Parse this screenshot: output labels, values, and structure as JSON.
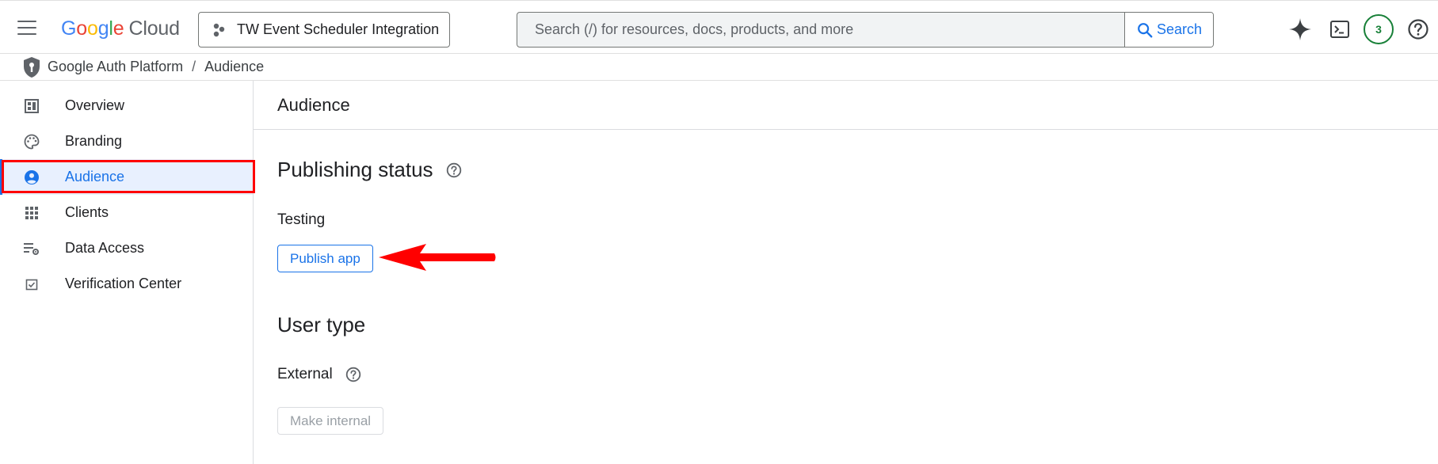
{
  "topbar": {
    "logo": {
      "letters": [
        "G",
        "o",
        "o",
        "g",
        "l",
        "e"
      ],
      "product": "Cloud"
    },
    "project_name": "TW Event Scheduler Integration",
    "search_placeholder": "Search (/) for resources, docs, products, and more",
    "search_button": "Search",
    "notification_count": "3",
    "icons": [
      "menu-icon",
      "gemini-spark-icon",
      "cloud-shell-icon",
      "help-icon"
    ]
  },
  "breadcrumb": {
    "root": "Google Auth Platform",
    "separator": "/",
    "current": "Audience"
  },
  "sidebar": {
    "items": [
      {
        "label": "Overview",
        "icon": "dashboard-icon",
        "active": false
      },
      {
        "label": "Branding",
        "icon": "palette-icon",
        "active": false
      },
      {
        "label": "Audience",
        "icon": "account-circle-icon",
        "active": true
      },
      {
        "label": "Clients",
        "icon": "apps-grid-icon",
        "active": false
      },
      {
        "label": "Data Access",
        "icon": "data-settings-icon",
        "active": false
      },
      {
        "label": "Verification Center",
        "icon": "checkbox-icon",
        "active": false
      }
    ]
  },
  "main": {
    "page_title": "Audience",
    "publishing": {
      "title": "Publishing status",
      "status": "Testing",
      "button": "Publish app"
    },
    "user_type": {
      "title": "User type",
      "value": "External",
      "button": "Make internal"
    }
  },
  "colors": {
    "accent": "#1a73e8",
    "active_bg": "#e8f0fe",
    "annotation_red": "#ff0000",
    "badge_green": "#188038"
  }
}
